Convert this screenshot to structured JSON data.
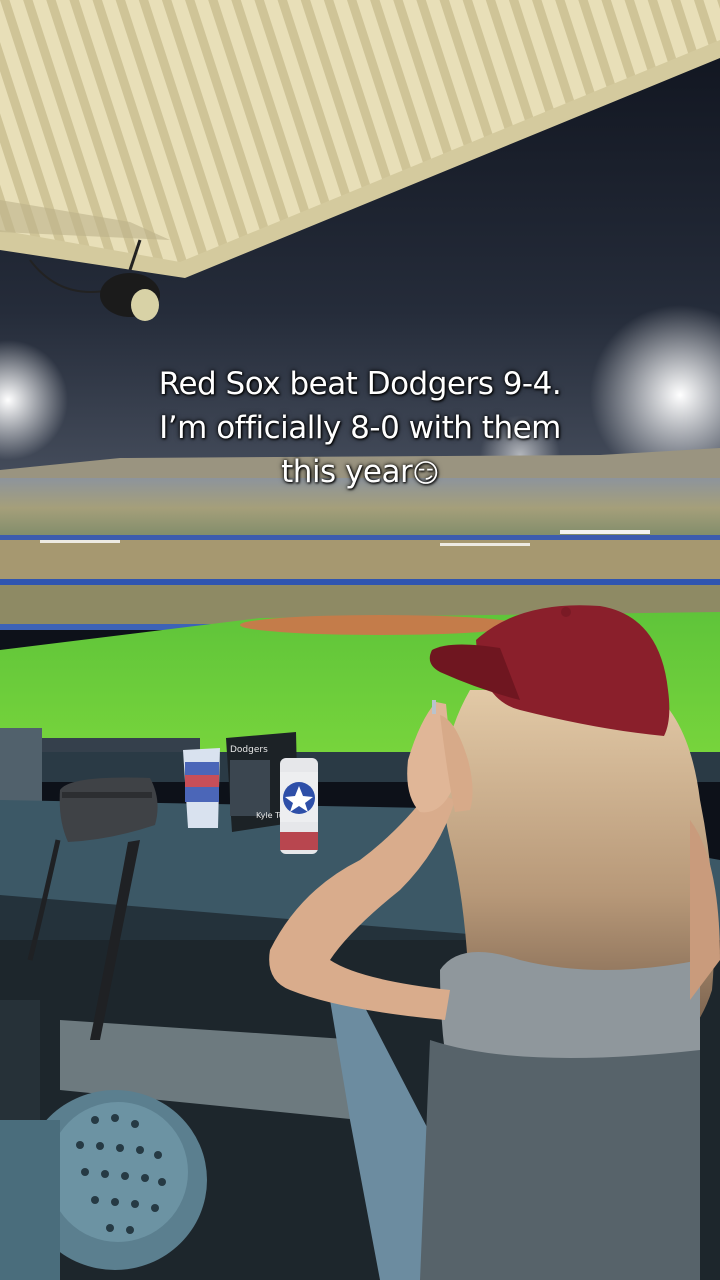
{
  "caption": {
    "line1": "Red Sox beat Dodgers 9-4.",
    "line2": "I’m officially 8-0 with them",
    "line3": "this year",
    "emoji": "😏"
  },
  "props": {
    "figurine_box_text": "Dodgers",
    "figurine_name": "Kyle Tucker"
  },
  "colors": {
    "sky": "#151a26",
    "field": "#6fd13a",
    "cap": "#8a1f2b",
    "counter": "#3c5866",
    "awning": "#e3d9b0"
  }
}
